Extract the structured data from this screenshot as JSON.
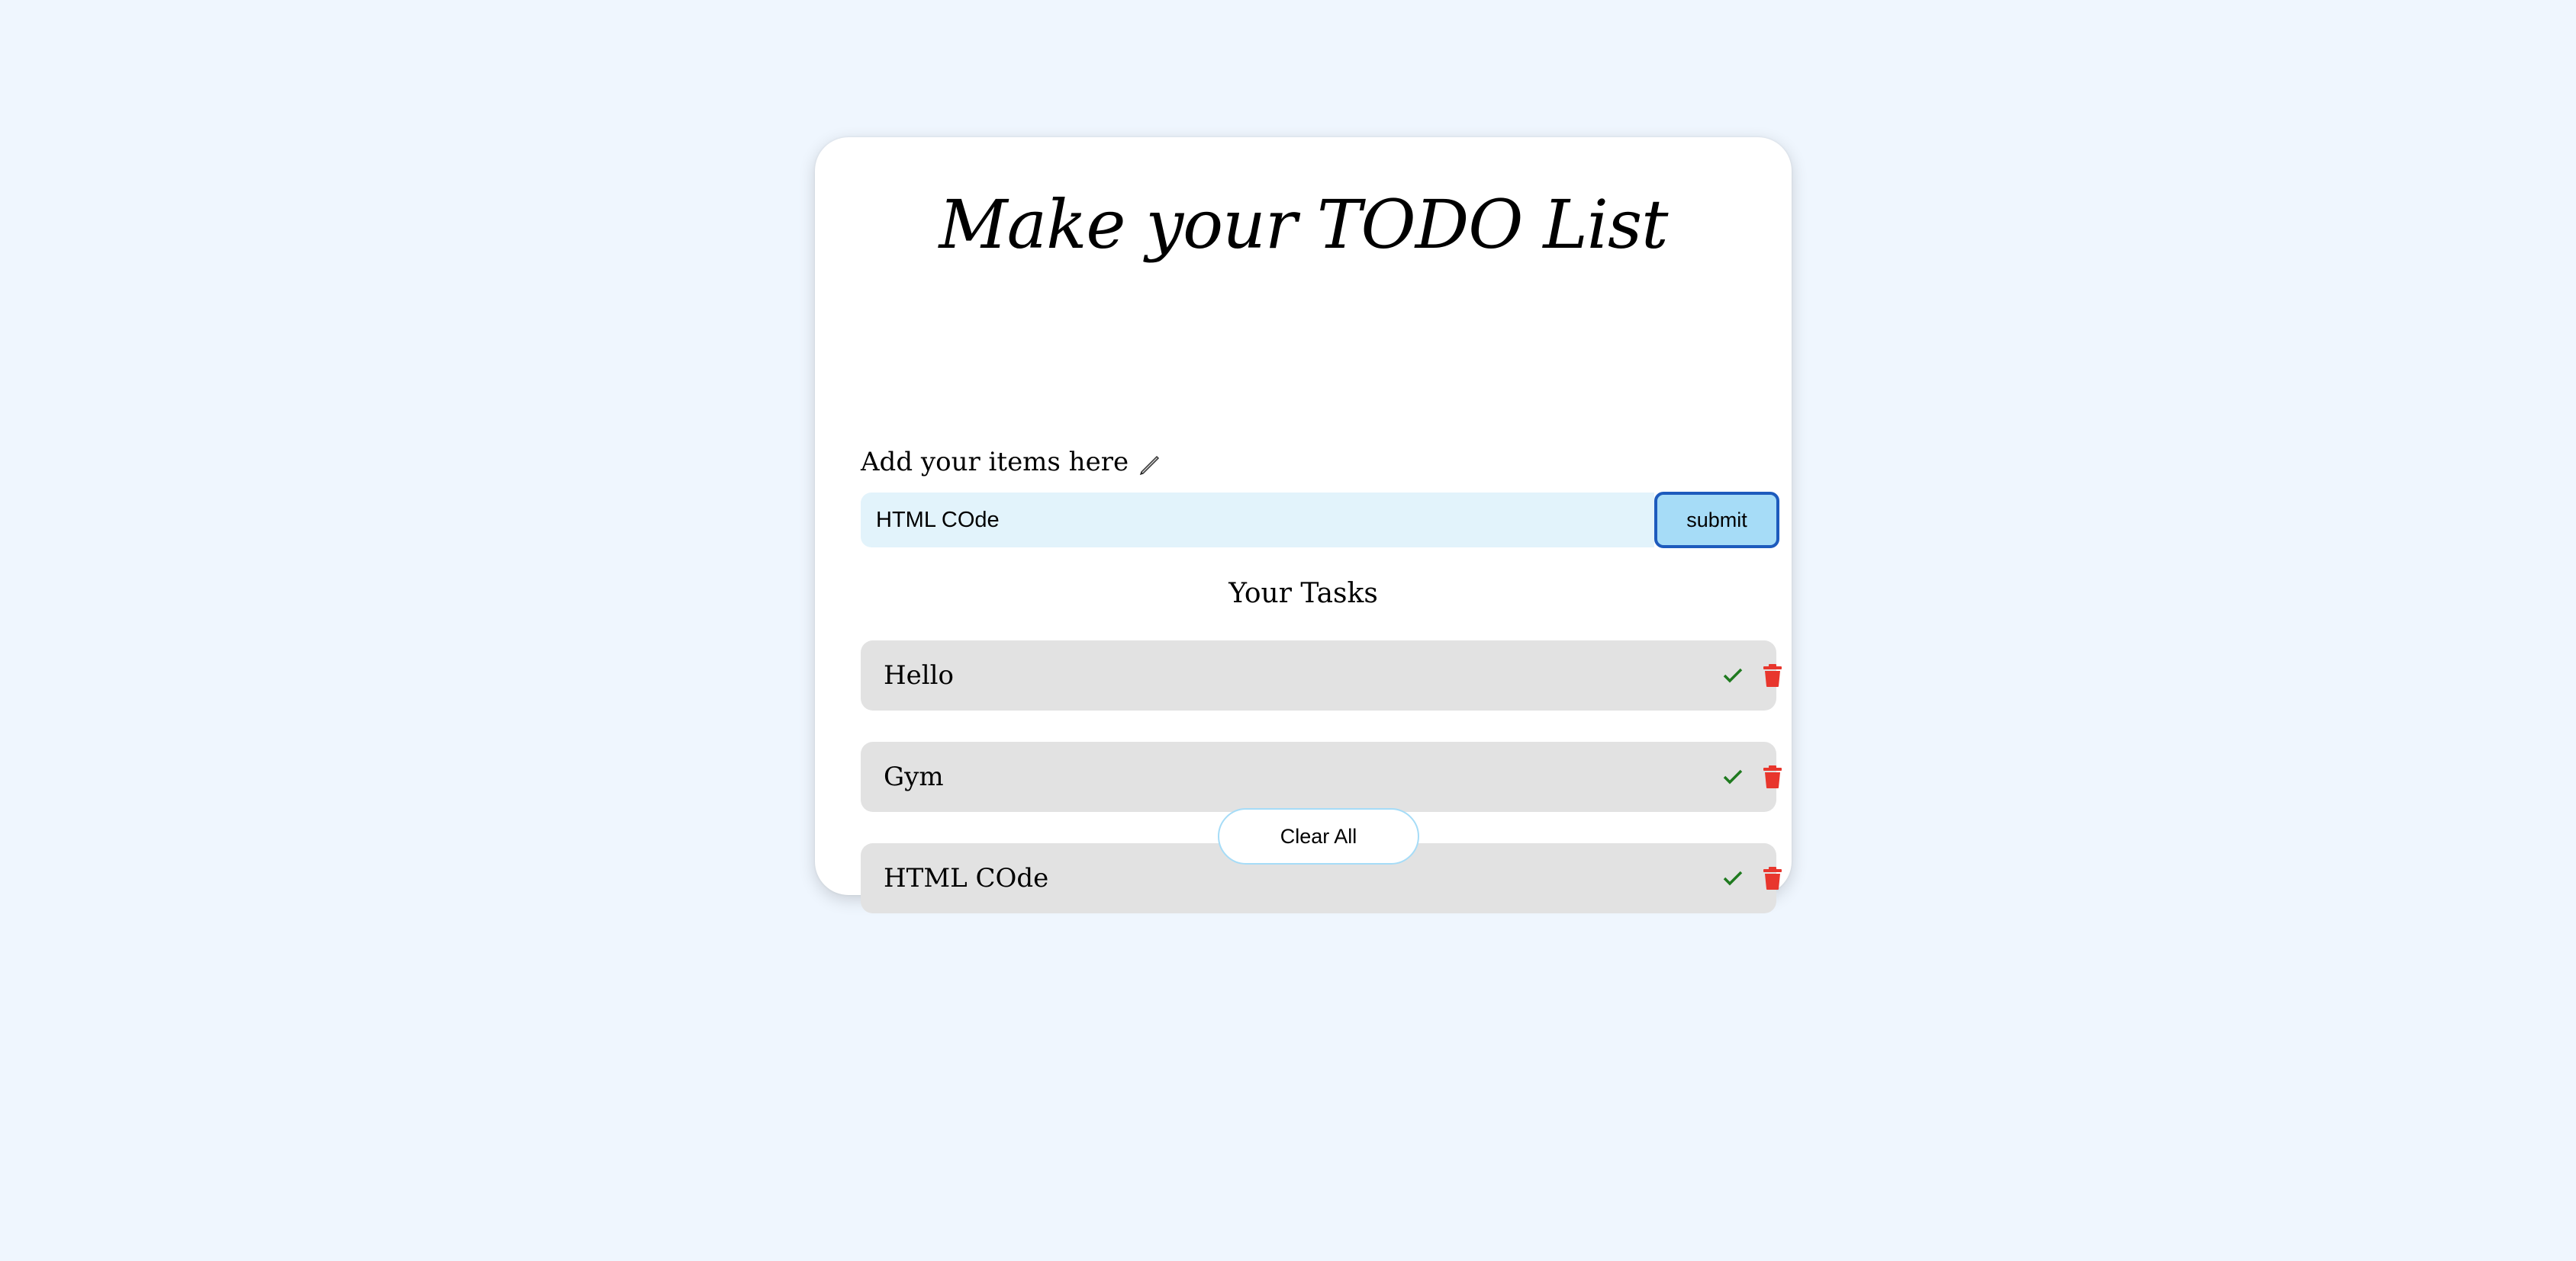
{
  "app": {
    "title": "Make your TODO List"
  },
  "form": {
    "label": "Add your items here",
    "input_value": "HTML COde",
    "submit_label": "submit"
  },
  "tasks": {
    "heading": "Your Tasks",
    "items": [
      {
        "text": "Hello"
      },
      {
        "text": "Gym"
      },
      {
        "text": "HTML COde"
      }
    ]
  },
  "actions": {
    "clear_all_label": "Clear All"
  },
  "colors": {
    "page_background": "#eff6fe",
    "input_background": "#e2f3fb",
    "submit_background": "#a6dcf7",
    "submit_border": "#1d5bbd",
    "task_background": "#e2e2e2",
    "check_icon": "#1f7a1f",
    "trash_icon": "#e8362d"
  },
  "icons": {
    "label_icon": "pen-icon",
    "complete_icon": "check-icon",
    "delete_icon": "trash-icon"
  }
}
